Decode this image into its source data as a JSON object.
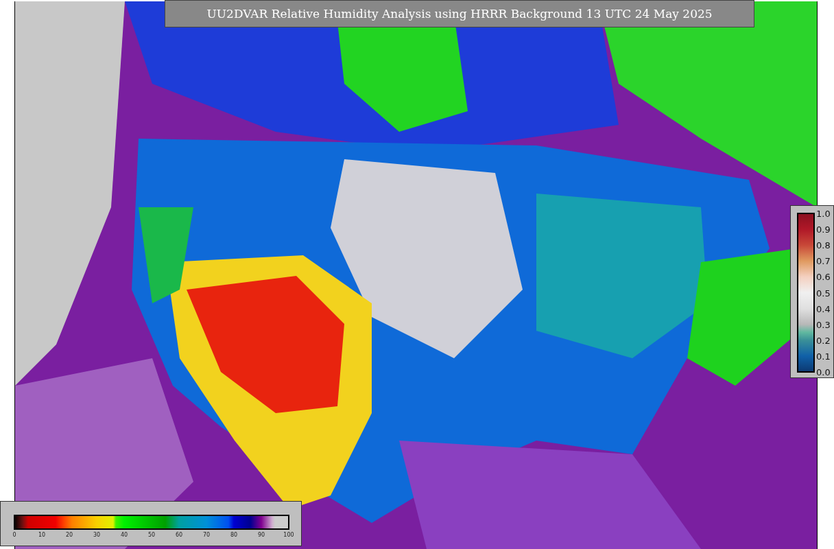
{
  "title": "UU2DVAR Relative Humidity Analysis using HRRR Background 13 UTC 24 May 2025",
  "humidity_colorbar": {
    "ticks": [
      "0",
      "10",
      "20",
      "30",
      "40",
      "50",
      "60",
      "70",
      "80",
      "90",
      "100"
    ]
  },
  "observation_colorbar": {
    "ticks": [
      "1.0",
      "0.9",
      "0.8",
      "0.7",
      "0.6",
      "0.5",
      "0.4",
      "0.3",
      "0.2",
      "0.1",
      "0.0"
    ]
  }
}
